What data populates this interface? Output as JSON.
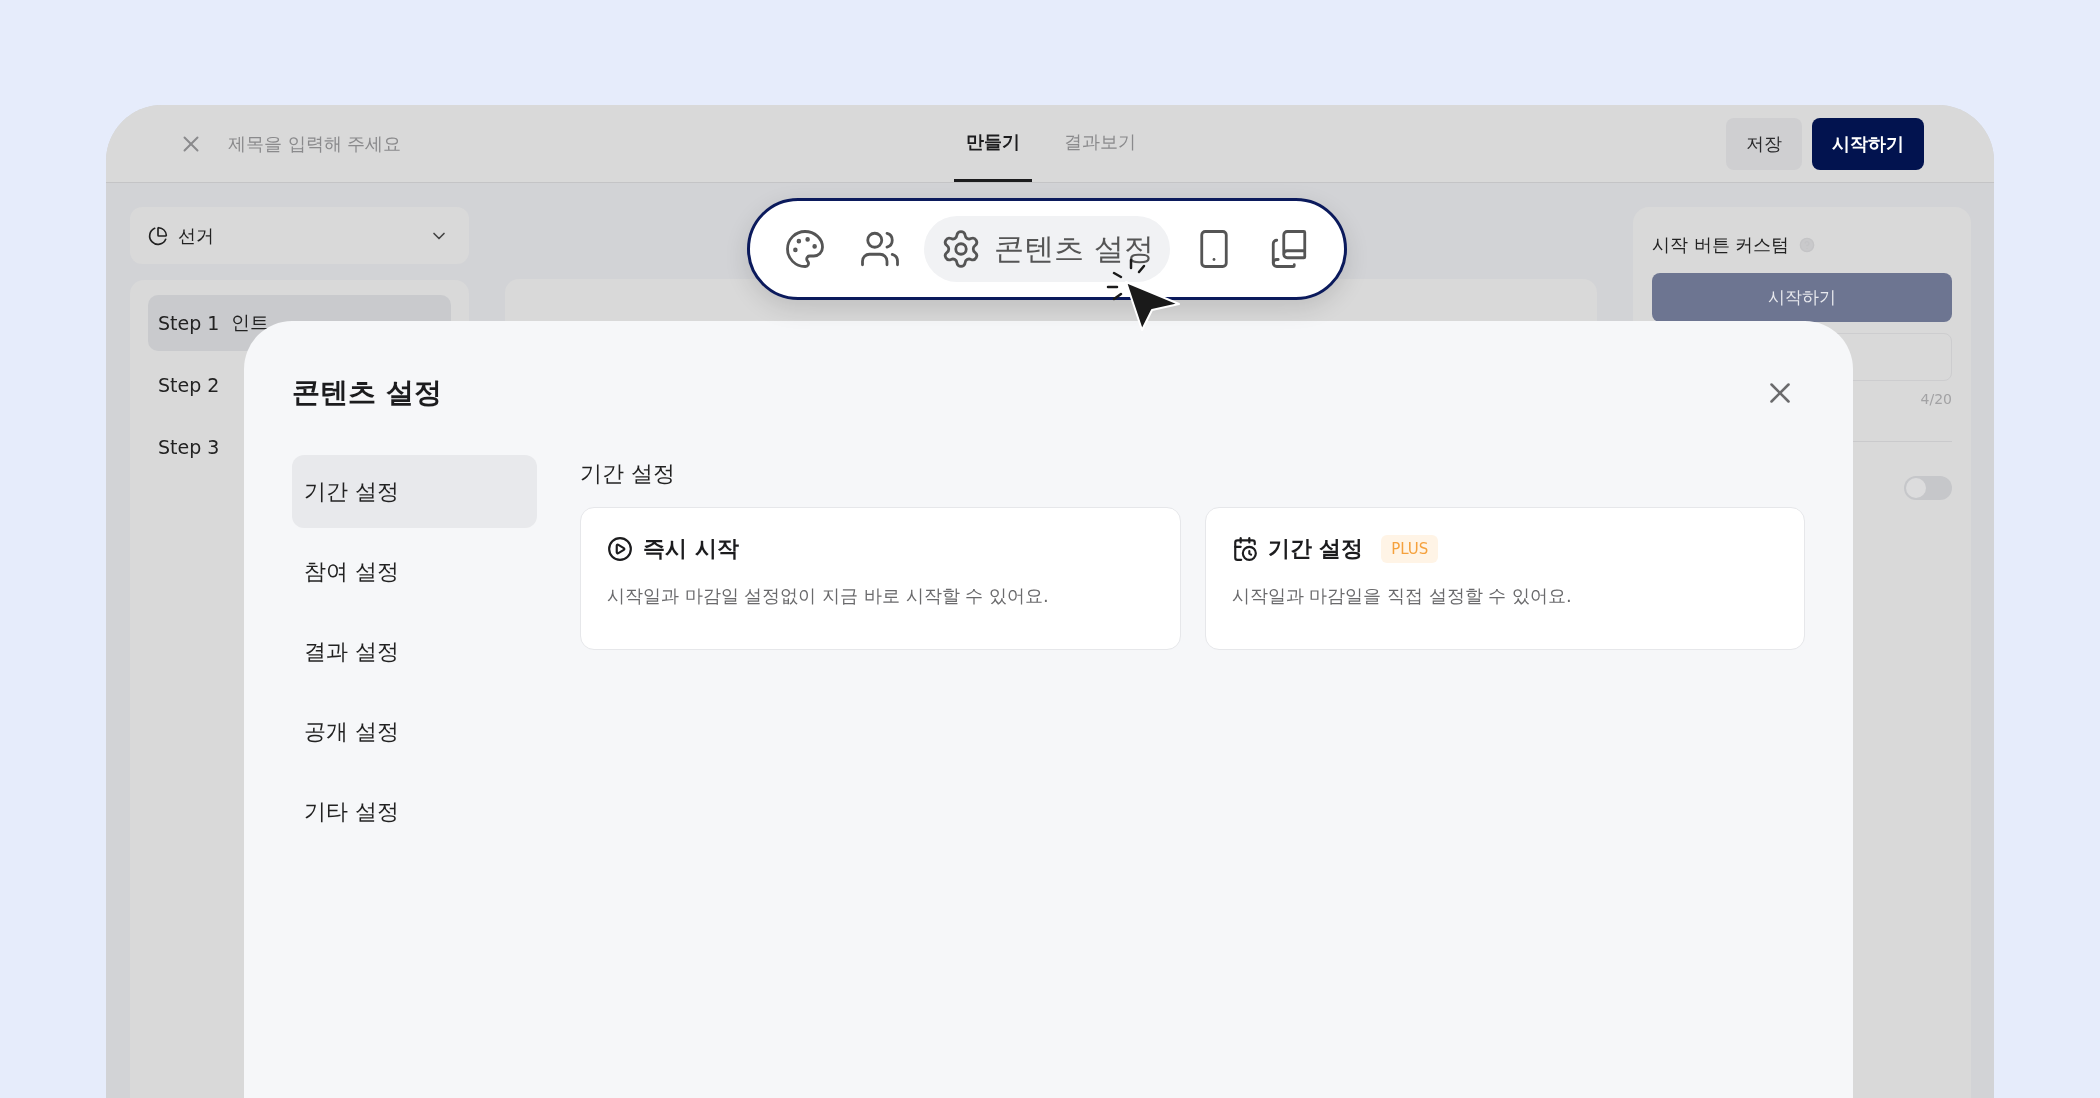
{
  "header": {
    "placeholder": "제목을 입력해 주세요",
    "tabs": [
      {
        "label": "만들기",
        "selected": true
      },
      {
        "label": "결과보기",
        "selected": false
      }
    ],
    "buttons": [
      {
        "label": "저장",
        "kind": "secondary"
      },
      {
        "label": "시작하기",
        "kind": "primary"
      }
    ]
  },
  "sidebar": {
    "dropdown": {
      "label": "선거"
    },
    "steps": [
      {
        "step": "Step 1",
        "title": "인트",
        "selected": true
      },
      {
        "step": "Step 2",
        "selected": false
      },
      {
        "step": "Step 3",
        "selected": false
      }
    ]
  },
  "right_panel": {
    "title": "시작 버튼 커스텀",
    "preview_button": "시작하기",
    "counter": "4/20",
    "toggle": {
      "on": false
    }
  },
  "toolbar": {
    "items": [
      {
        "kind": "palette",
        "selected": false
      },
      {
        "kind": "people",
        "selected": false
      },
      {
        "kind": "settings",
        "label": "콘텐츠 설정",
        "selected": true
      },
      {
        "kind": "phone",
        "selected": false
      },
      {
        "kind": "book",
        "selected": false
      }
    ]
  },
  "modal": {
    "title": "콘텐츠 설정",
    "nav": [
      {
        "label": "기간 설정",
        "selected": true
      },
      {
        "label": "참여 설정",
        "selected": false
      },
      {
        "label": "결과 설정",
        "selected": false
      },
      {
        "label": "공개 설정",
        "selected": false
      },
      {
        "label": "기타 설정",
        "selected": false
      }
    ],
    "section_title": "기간 설정",
    "options": [
      {
        "kind": "instant",
        "title": "즉시 시작",
        "description": "시작일과 마감일 설정없이 지금 바로 시작할 수 있어요."
      },
      {
        "kind": "scheduled",
        "title": "기간 설정",
        "badge": "PLUS",
        "description": "시작일과 마감일을 직접 설정할 수 있어요."
      }
    ]
  }
}
